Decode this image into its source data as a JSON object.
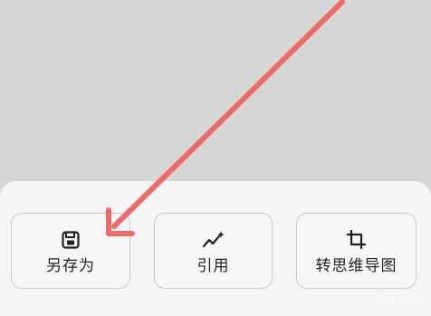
{
  "actions": [
    {
      "label": "另存为",
      "icon": "save-icon"
    },
    {
      "label": "引用",
      "icon": "sparkle-trend-icon"
    },
    {
      "label": "转思维导图",
      "icon": "crop-icon"
    }
  ],
  "watermark": "Bai 经验",
  "colors": {
    "background": "#d6d6d6",
    "sheet": "#f5f5f7",
    "annotation_arrow": "#ec6b67"
  }
}
